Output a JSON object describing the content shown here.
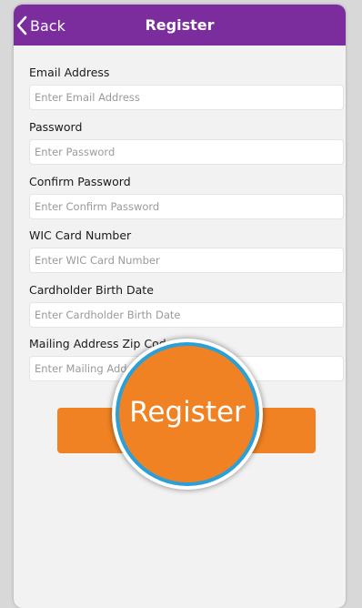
{
  "header": {
    "back_label": "Back",
    "title": "Register"
  },
  "form": {
    "fields": [
      {
        "label": "Email Address",
        "placeholder": "Enter Email Address"
      },
      {
        "label": "Password",
        "placeholder": "Enter Password"
      },
      {
        "label": "Confirm Password",
        "placeholder": "Enter Confirm Password"
      },
      {
        "label": "WIC Card Number",
        "placeholder": "Enter WIC Card Number"
      },
      {
        "label": "Cardholder Birth Date",
        "placeholder": "Enter Cardholder Birth Date"
      },
      {
        "label": "Mailing Address Zip Code",
        "placeholder": "Enter Mailing Address Zip Code"
      }
    ],
    "submit_label": "Register"
  },
  "magnifier": {
    "label": "Register"
  },
  "colors": {
    "header_bg": "#7b2c9d",
    "button_bg": "#f08224",
    "magnifier_ring": "#2a9fd8",
    "page_bg": "#f2f2f2"
  },
  "icons": {
    "back": "chevron-left-icon"
  }
}
